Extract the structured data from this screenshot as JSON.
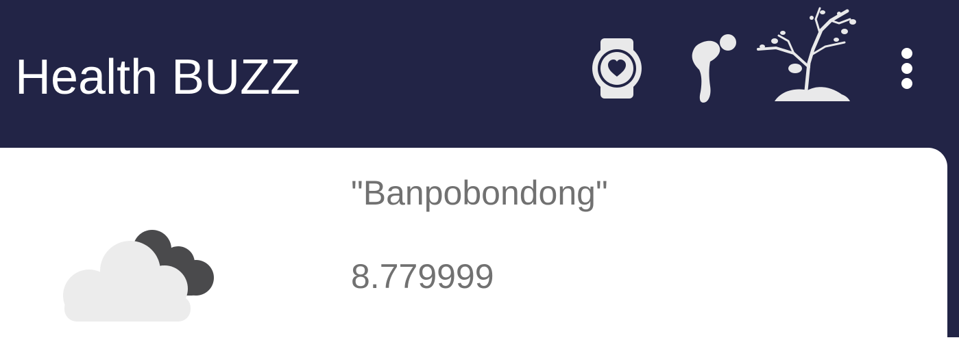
{
  "app_bar": {
    "title": "Health BUZZ",
    "background_color": "#222446",
    "icons": [
      "smartwatch-heart-icon",
      "posture-icon",
      "tree-icon",
      "more-vert-icon"
    ]
  },
  "weather_card": {
    "location": "\"Banpobondong\"",
    "value": "8.779999",
    "icon": "cloudy-icon",
    "text_color": "#717171"
  }
}
